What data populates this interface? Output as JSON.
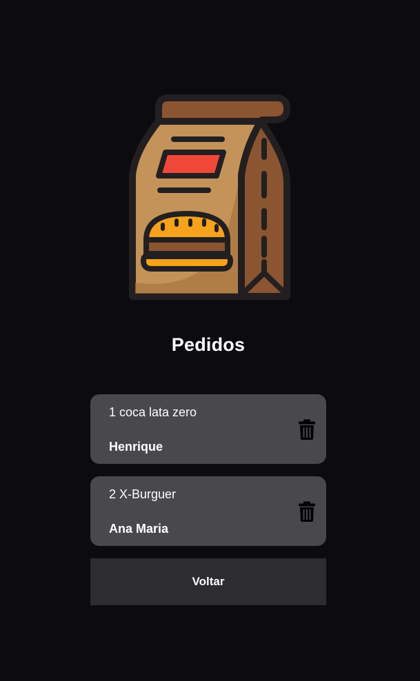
{
  "header": {
    "logo_icon": "food-bag-burger-icon",
    "title": "Pedidos"
  },
  "orders": [
    {
      "item": "1 coca lata zero",
      "customer": "Henrique",
      "delete_icon": "trash-icon"
    },
    {
      "item": "2 X-Burguer",
      "customer": "Ana Maria",
      "delete_icon": "trash-icon"
    }
  ],
  "actions": {
    "back_label": "Voltar"
  },
  "colors": {
    "background": "#0b0b10",
    "card": "#48484d",
    "button": "#2c2c31",
    "bag_main": "#c4935a",
    "bag_dark": "#8b5532",
    "bun": "#f7a21c",
    "label_red": "#f04838",
    "outline": "#231f20"
  }
}
